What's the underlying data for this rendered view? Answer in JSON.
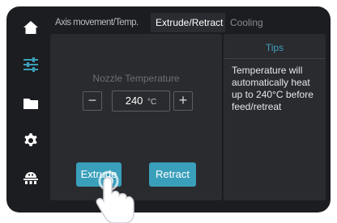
{
  "sidebar": {
    "items": [
      {
        "icon": "home-icon"
      },
      {
        "icon": "sliders-icon",
        "active": true
      },
      {
        "icon": "folder-icon"
      },
      {
        "icon": "gear-icon"
      },
      {
        "icon": "robot-icon"
      }
    ]
  },
  "tabs": [
    {
      "label": "Axis movement/Temp.",
      "active": false
    },
    {
      "label": "Extrude/Retract",
      "active": true
    },
    {
      "label": "Cooling",
      "active": false
    }
  ],
  "nozzle": {
    "label": "Nozzle Temperature",
    "minus": "−",
    "plus": "+",
    "value": "240",
    "unit": "°C"
  },
  "actions": {
    "extrude": "Extrude",
    "retract": "Retract"
  },
  "tips": {
    "title": "Tips",
    "body": "Temperature will automatically heat up to 240°C before feed/retreat"
  },
  "colors": {
    "accent": "#3a9fbb",
    "background": "#1c1d20",
    "panel": "#2a2b2f",
    "active_icon": "#3a9fbb"
  }
}
